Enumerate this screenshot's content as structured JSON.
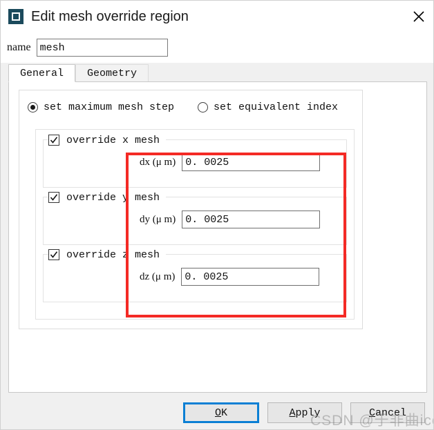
{
  "window": {
    "title": "Edit mesh override region",
    "icon": "mesh-region-icon",
    "close_icon": "close-icon"
  },
  "name_field": {
    "label": "name",
    "value": "mesh",
    "placeholder": ""
  },
  "tabs": [
    {
      "label": "General",
      "active": true
    },
    {
      "label": "Geometry",
      "active": false
    }
  ],
  "mode_options": [
    {
      "label": "set maximum mesh step",
      "selected": true
    },
    {
      "label": "set equivalent index",
      "selected": false
    }
  ],
  "axis_groups": [
    {
      "checkbox_label": "override x mesh",
      "checked": true,
      "field_label": "dx (μ m)",
      "field_value": "0. 0025"
    },
    {
      "checkbox_label": "override y mesh",
      "checked": true,
      "field_label": "dy (μ m)",
      "field_value": "0. 0025"
    },
    {
      "checkbox_label": "override z mesh",
      "checked": true,
      "field_label": "dz (μ m)",
      "field_value": "0. 0025"
    }
  ],
  "buttons": [
    {
      "label": "OK",
      "mnemonic": "O",
      "rest": "K",
      "default": true
    },
    {
      "label": "Apply",
      "mnemonic": "A",
      "rest": "pply",
      "default": false
    },
    {
      "label": "Cancel",
      "mnemonic": "C",
      "rest": "ancel",
      "default": false
    }
  ],
  "annotation": {
    "name": "red-highlight-rectangle",
    "color": "#f42a25"
  },
  "watermark": {
    "text": "CSDN @于非曲icon"
  }
}
